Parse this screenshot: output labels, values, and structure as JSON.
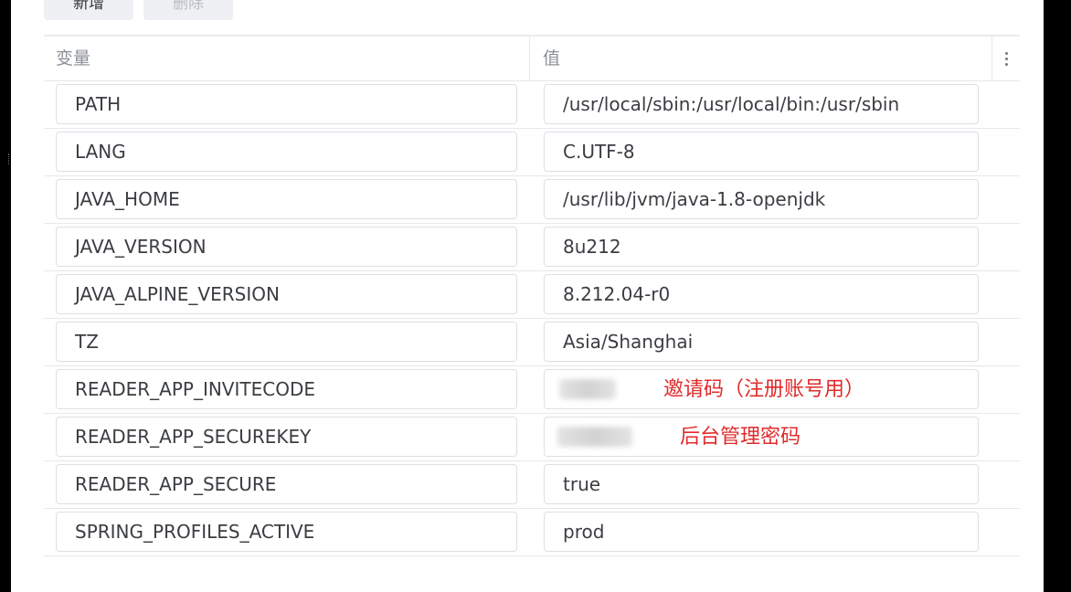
{
  "toolbar": {
    "add_label": "新增",
    "delete_label": "删除"
  },
  "table": {
    "headers": {
      "variable": "变量",
      "value": "值"
    },
    "rows": [
      {
        "key": "PATH",
        "value": "/usr/local/sbin:/usr/local/bin:/usr/sbin"
      },
      {
        "key": "LANG",
        "value": "C.UTF-8"
      },
      {
        "key": "JAVA_HOME",
        "value": "/usr/lib/jvm/java-1.8-openjdk"
      },
      {
        "key": "JAVA_VERSION",
        "value": "8u212"
      },
      {
        "key": "JAVA_ALPINE_VERSION",
        "value": "8.212.04-r0"
      },
      {
        "key": "TZ",
        "value": "Asia/Shanghai"
      },
      {
        "key": "READER_APP_INVITECODE",
        "value": "",
        "annotation": "邀请码（注册账号用）"
      },
      {
        "key": "READER_APP_SECUREKEY",
        "value": "",
        "annotation": "后台管理密码"
      },
      {
        "key": "READER_APP_SECURE",
        "value": "true"
      },
      {
        "key": "SPRING_PROFILES_ACTIVE",
        "value": "prod"
      }
    ]
  },
  "colors": {
    "annotation": "#e02b2b",
    "border": "#dcdfe4",
    "header_text": "#8b9097"
  },
  "icons": {
    "column_menu": "more-vertical-icon"
  }
}
